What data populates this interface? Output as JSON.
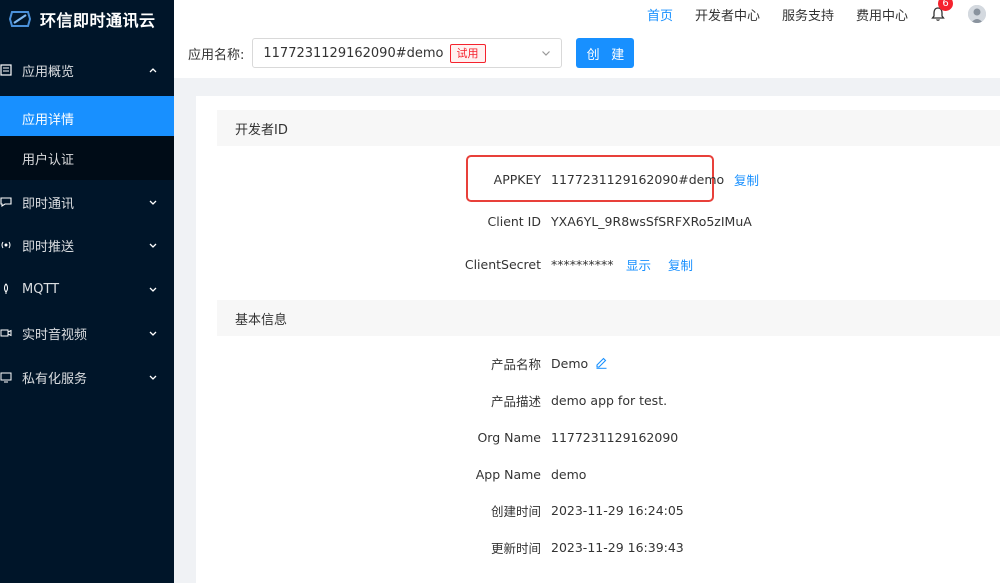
{
  "brand": {
    "title": "环信即时通讯云"
  },
  "sidebar": {
    "groups": [
      {
        "label": "应用概览",
        "icon": "overview-icon",
        "expanded": true,
        "children": [
          {
            "label": "应用详情",
            "active": true
          },
          {
            "label": "用户认证"
          }
        ]
      },
      {
        "label": "即时通讯",
        "icon": "chat-icon"
      },
      {
        "label": "即时推送",
        "icon": "push-icon"
      },
      {
        "label": "MQTT",
        "icon": "mqtt-icon"
      },
      {
        "label": "实时音视频",
        "icon": "video-icon"
      },
      {
        "label": "私有化服务",
        "icon": "monitor-icon"
      }
    ]
  },
  "topnav": {
    "items": [
      "首页",
      "开发者中心",
      "服务支持",
      "费用中心"
    ],
    "active": "首页",
    "notification_count": "6"
  },
  "selector": {
    "label": "应用名称:",
    "value": "1177231129162090#demo",
    "tag": "试用",
    "create_label": "创 建"
  },
  "developer": {
    "heading": "开发者ID",
    "appkey_label": "APPKEY",
    "appkey_value": "1177231129162090#demo",
    "copy_label": "复制",
    "client_id_label": "Client ID",
    "client_id_value": "YXA6YL_9R8wsSfSRFXRo5zIMuA",
    "client_secret_label": "ClientSecret",
    "client_secret_value": "**********",
    "show_label": "显示"
  },
  "basic": {
    "heading": "基本信息",
    "product_name_label": "产品名称",
    "product_name_value": "Demo",
    "product_desc_label": "产品描述",
    "product_desc_value": "demo app for test.",
    "org_name_label": "Org Name",
    "org_name_value": "1177231129162090",
    "app_name_label": "App Name",
    "app_name_value": "demo",
    "created_label": "创建时间",
    "created_value": "2023-11-29 16:24:05",
    "updated_label": "更新时间",
    "updated_value": "2023-11-29 16:39:43"
  },
  "colors": {
    "primary": "#1890ff",
    "sidebar": "#001529",
    "danger": "#f5222d"
  }
}
